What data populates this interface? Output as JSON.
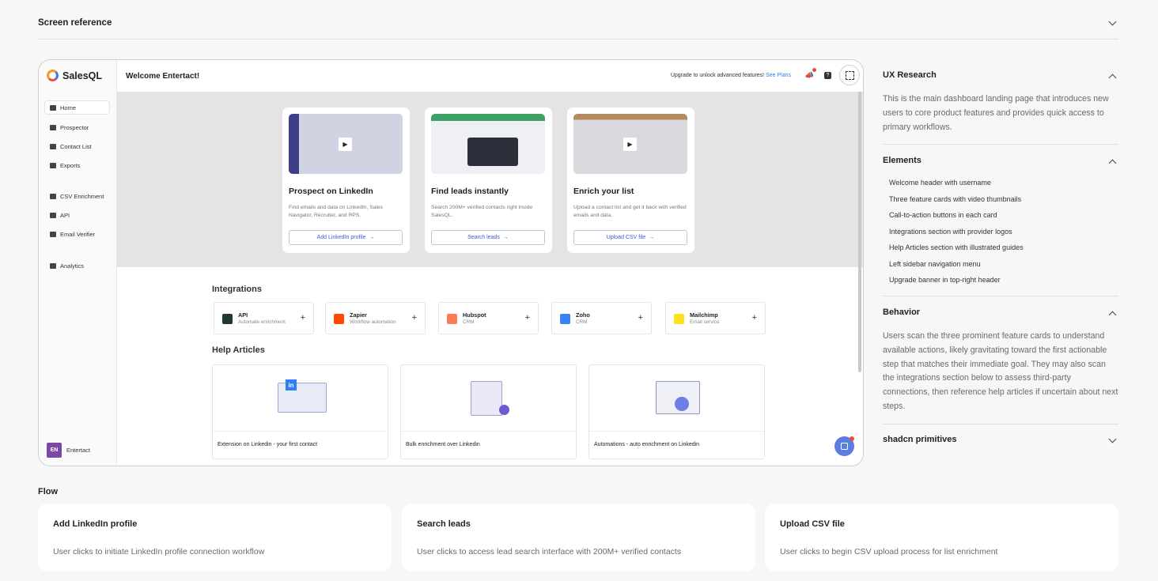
{
  "screen_reference": {
    "title": "Screen reference"
  },
  "app": {
    "brand": "SalesQL",
    "welcome": "Welcome Entertact!",
    "upgrade_text": "Upgrade to unlock advanced features!",
    "upgrade_link": "See Plans",
    "sidebar": [
      {
        "label": "Home"
      },
      {
        "label": "Prospector"
      },
      {
        "label": "Contact List"
      },
      {
        "label": "Exports"
      },
      {
        "label": "CSV Enrichment"
      },
      {
        "label": "API"
      },
      {
        "label": "Email Verifier"
      },
      {
        "label": "Analytics"
      }
    ],
    "user": {
      "initials": "EN",
      "name": "Entertact"
    },
    "feature_cards": [
      {
        "title": "Prospect on LinkedIn",
        "desc": "Find emails and data on LinkedIn, Sales Navigator, Recruiter, and RPS.",
        "button": "Add LinkedIn profile"
      },
      {
        "title": "Find leads instantly",
        "desc": "Search 200M+ verified contacts right inside SalesQL.",
        "button": "Search leads"
      },
      {
        "title": "Enrich your list",
        "desc": "Upload a contact list and get it back with verified emails and data.",
        "button": "Upload CSV file"
      }
    ],
    "integrations_title": "Integrations",
    "integrations": [
      {
        "name": "API",
        "desc": "Automate enrichment",
        "color": "#1f3b2f"
      },
      {
        "name": "Zapier",
        "desc": "Workflow automation",
        "color": "#ff4a00"
      },
      {
        "name": "Hubspot",
        "desc": "CRM",
        "color": "#ff7a59"
      },
      {
        "name": "Zoho",
        "desc": "CRM",
        "color": "#3b82f6"
      },
      {
        "name": "Mailchimp",
        "desc": "Email service",
        "color": "#ffe01b"
      }
    ],
    "help_title": "Help Articles",
    "help_articles": [
      {
        "caption": "Extension on Linkedin - your first contact"
      },
      {
        "caption": "Bulk enrichment over Linkedin"
      },
      {
        "caption": "Automations - auto enrichment on Linkedin"
      }
    ]
  },
  "panel": {
    "ux_title": "UX Research",
    "ux_text": "This is the main dashboard landing page that introduces new users to core product features and provides quick access to primary workflows.",
    "elements_title": "Elements",
    "elements": [
      "Welcome header with username",
      "Three feature cards with video thumbnails",
      "Call-to-action buttons in each card",
      "Integrations section with provider logos",
      "Help Articles section with illustrated guides",
      "Left sidebar navigation menu",
      "Upgrade banner in top-right header"
    ],
    "behavior_title": "Behavior",
    "behavior_text": "Users scan the three prominent feature cards to understand available actions, likely gravitating toward the first actionable step that matches their immediate goal. They may also scan the integrations section below to assess third-party connections, then reference help articles if uncertain about next steps.",
    "shadcn_title": "shadcn primitives"
  },
  "flow": {
    "label": "Flow",
    "steps": [
      {
        "title": "Add LinkedIn profile",
        "desc": "User clicks to initiate LinkedIn profile connection workflow"
      },
      {
        "title": "Search leads",
        "desc": "User clicks to access lead search interface with 200M+ verified contacts"
      },
      {
        "title": "Upload CSV file",
        "desc": "User clicks to begin CSV upload process for list enrichment"
      }
    ]
  },
  "icons": [
    "home-icon",
    "search-icon",
    "list-icon",
    "download-icon",
    "csv-icon",
    "api-icon",
    "mail-check-icon",
    "analytics-icon",
    "megaphone-icon",
    "help-icon",
    "fullscreen-icon",
    "arrow-right-icon",
    "plus-icon",
    "chat-icon",
    "play-icon"
  ]
}
